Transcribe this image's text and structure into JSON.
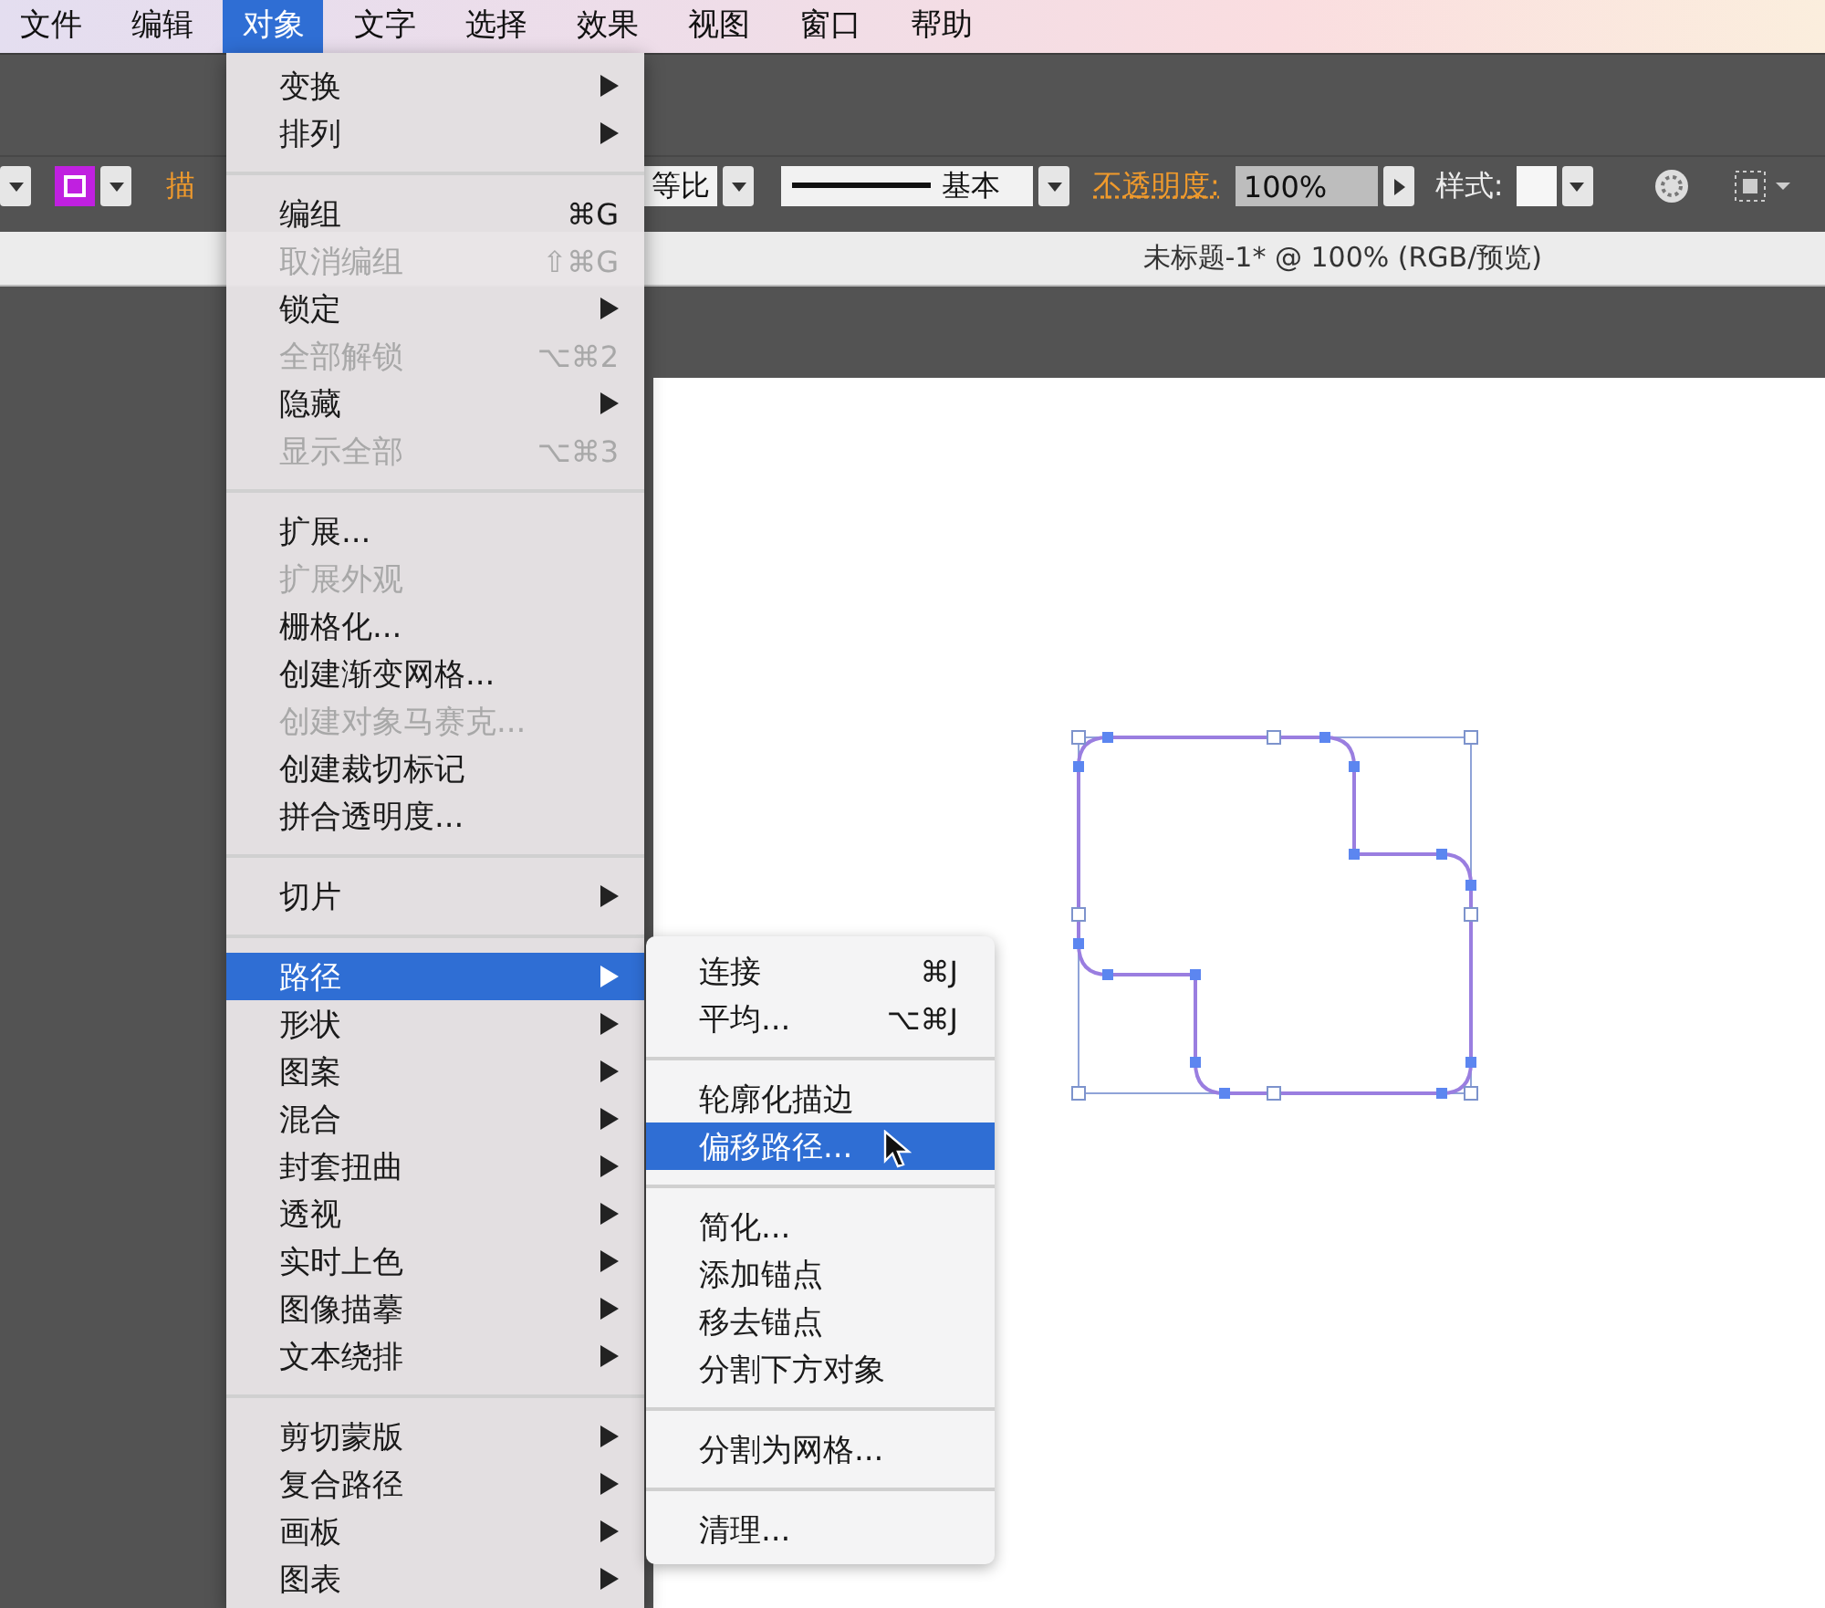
{
  "menubar": {
    "items": [
      {
        "label": "文件",
        "selected": false
      },
      {
        "label": "编辑",
        "selected": false
      },
      {
        "label": "对象",
        "selected": true
      },
      {
        "label": "文字",
        "selected": false
      },
      {
        "label": "选择",
        "selected": false
      },
      {
        "label": "效果",
        "selected": false
      },
      {
        "label": "视图",
        "selected": false
      },
      {
        "label": "窗口",
        "selected": false
      },
      {
        "label": "帮助",
        "selected": false
      }
    ]
  },
  "control_bar": {
    "stroke_label": "描",
    "ratio_value": "等比",
    "profile_value": "基本",
    "opacity_label": "不透明度:",
    "opacity_value": "100%",
    "style_label": "样式:"
  },
  "document_tab": {
    "title": "未标题-1* @ 100% (RGB/预览)"
  },
  "object_menu": {
    "sections": [
      {
        "items": [
          {
            "label": "变换",
            "submenu": true,
            "disabled": false,
            "selected": false
          },
          {
            "label": "排列",
            "submenu": true,
            "disabled": false,
            "selected": false
          }
        ]
      },
      {
        "items": [
          {
            "label": "编组",
            "shortcut": "⌘G",
            "submenu": false,
            "disabled": false,
            "selected": false
          },
          {
            "label": "取消编组",
            "shortcut": "⇧⌘G",
            "submenu": false,
            "disabled": true,
            "selected": false
          },
          {
            "label": "锁定",
            "submenu": true,
            "disabled": false,
            "selected": false
          },
          {
            "label": "全部解锁",
            "shortcut": "⌥⌘2",
            "submenu": false,
            "disabled": true,
            "selected": false
          },
          {
            "label": "隐藏",
            "submenu": true,
            "disabled": false,
            "selected": false
          },
          {
            "label": "显示全部",
            "shortcut": "⌥⌘3",
            "submenu": false,
            "disabled": true,
            "selected": false
          }
        ]
      },
      {
        "items": [
          {
            "label": "扩展...",
            "submenu": false,
            "disabled": false,
            "selected": false
          },
          {
            "label": "扩展外观",
            "submenu": false,
            "disabled": true,
            "selected": false
          },
          {
            "label": "栅格化...",
            "submenu": false,
            "disabled": false,
            "selected": false
          },
          {
            "label": "创建渐变网格...",
            "submenu": false,
            "disabled": false,
            "selected": false
          },
          {
            "label": "创建对象马赛克...",
            "submenu": false,
            "disabled": true,
            "selected": false
          },
          {
            "label": "创建裁切标记",
            "submenu": false,
            "disabled": false,
            "selected": false
          },
          {
            "label": "拼合透明度...",
            "submenu": false,
            "disabled": false,
            "selected": false
          }
        ]
      },
      {
        "items": [
          {
            "label": "切片",
            "submenu": true,
            "disabled": false,
            "selected": false
          }
        ]
      },
      {
        "items": [
          {
            "label": "路径",
            "submenu": true,
            "disabled": false,
            "selected": true
          },
          {
            "label": "形状",
            "submenu": true,
            "disabled": false,
            "selected": false
          },
          {
            "label": "图案",
            "submenu": true,
            "disabled": false,
            "selected": false
          },
          {
            "label": "混合",
            "submenu": true,
            "disabled": false,
            "selected": false
          },
          {
            "label": "封套扭曲",
            "submenu": true,
            "disabled": false,
            "selected": false
          },
          {
            "label": "透视",
            "submenu": true,
            "disabled": false,
            "selected": false
          },
          {
            "label": "实时上色",
            "submenu": true,
            "disabled": false,
            "selected": false
          },
          {
            "label": "图像描摹",
            "submenu": true,
            "disabled": false,
            "selected": false
          },
          {
            "label": "文本绕排",
            "submenu": true,
            "disabled": false,
            "selected": false
          }
        ]
      },
      {
        "items": [
          {
            "label": "剪切蒙版",
            "submenu": true,
            "disabled": false,
            "selected": false
          },
          {
            "label": "复合路径",
            "submenu": true,
            "disabled": false,
            "selected": false
          },
          {
            "label": "画板",
            "submenu": true,
            "disabled": false,
            "selected": false
          },
          {
            "label": "图表",
            "submenu": true,
            "disabled": false,
            "selected": false
          }
        ]
      }
    ]
  },
  "path_submenu": {
    "sections": [
      {
        "items": [
          {
            "label": "连接",
            "shortcut": "⌘J",
            "selected": false
          },
          {
            "label": "平均...",
            "shortcut": "⌥⌘J",
            "selected": false
          }
        ]
      },
      {
        "items": [
          {
            "label": "轮廓化描边",
            "selected": false
          },
          {
            "label": "偏移路径...",
            "selected": true
          }
        ]
      },
      {
        "items": [
          {
            "label": "简化...",
            "selected": false
          },
          {
            "label": "添加锚点",
            "selected": false
          },
          {
            "label": "移去锚点",
            "selected": false
          },
          {
            "label": "分割下方对象",
            "selected": false
          }
        ]
      },
      {
        "items": [
          {
            "label": "分割为网格...",
            "selected": false
          }
        ]
      },
      {
        "items": [
          {
            "label": "清理...",
            "selected": false
          }
        ]
      }
    ]
  }
}
